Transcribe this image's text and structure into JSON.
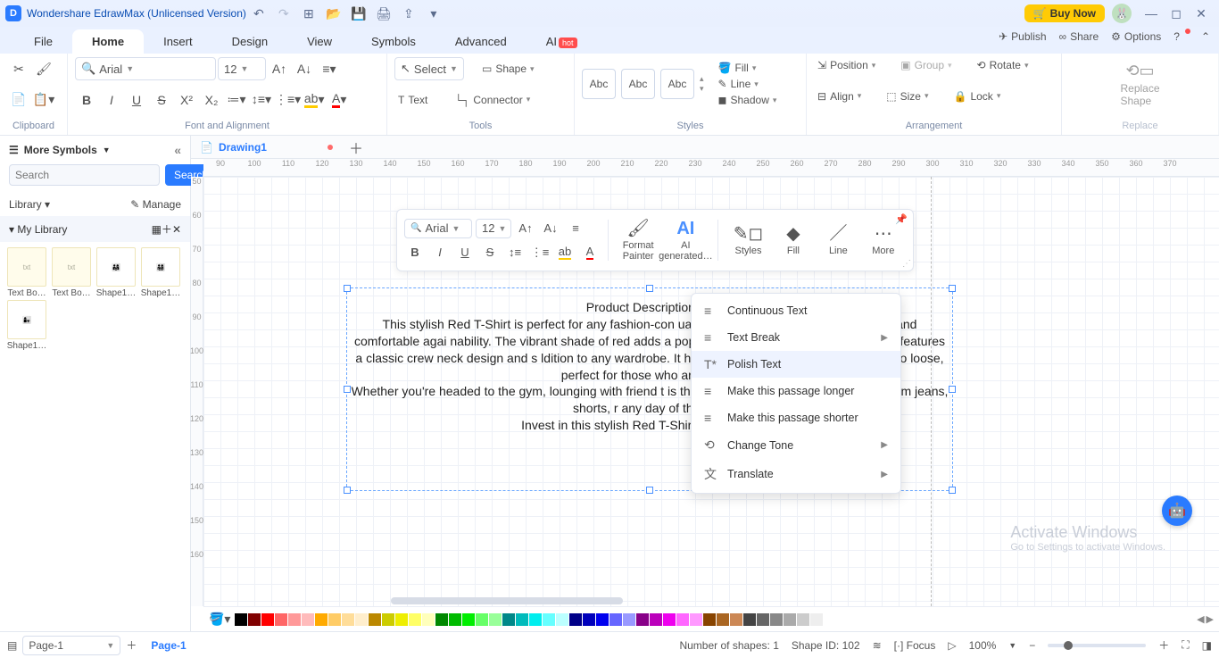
{
  "titlebar": {
    "app_name": "Wondershare EdrawMax (Unlicensed Version)",
    "buy_now": "Buy Now"
  },
  "menubar": {
    "tabs": [
      "File",
      "Home",
      "Insert",
      "Design",
      "View",
      "Symbols",
      "Advanced",
      "AI"
    ],
    "active": "Home",
    "right": {
      "publish": "Publish",
      "share": "Share",
      "options": "Options"
    }
  },
  "ribbon": {
    "font_name": "Arial",
    "font_size": "12",
    "select": "Select",
    "shape": "Shape",
    "text": "Text",
    "connector": "Connector",
    "fill": "Fill",
    "line": "Line",
    "shadow": "Shadow",
    "position": "Position",
    "align": "Align",
    "group": "Group",
    "size": "Size",
    "rotate": "Rotate",
    "lock": "Lock",
    "replace_shape": "Replace\nShape",
    "groups": {
      "clipboard": "Clipboard",
      "font": "Font and Alignment",
      "tools": "Tools",
      "styles": "Styles",
      "arrangement": "Arrangement",
      "replace": "Replace"
    },
    "abc": "Abc"
  },
  "leftpanel": {
    "more_symbols": "More Symbols",
    "search_placeholder": "Search",
    "search_btn": "Search",
    "library": "Library",
    "manage": "Manage",
    "my_library": "My Library",
    "items": [
      "Text Bo…",
      "Text Bo…",
      "Shape1…",
      "Shape1…",
      "Shape1…"
    ]
  },
  "doctab": {
    "name": "Drawing1"
  },
  "ruler_h": [
    "90",
    "100",
    "110",
    "120",
    "130",
    "140",
    "150",
    "160",
    "170",
    "180",
    "190",
    "200",
    "210",
    "220",
    "230",
    "240",
    "250",
    "260",
    "270",
    "280",
    "290",
    "300",
    "310",
    "320",
    "330",
    "340",
    "350",
    "360",
    "370"
  ],
  "ruler_v": [
    "50",
    "60",
    "70",
    "80",
    "90",
    "100",
    "110",
    "120",
    "130",
    "140",
    "150",
    "160"
  ],
  "canvas_text": {
    "title": "Product Description for",
    "body": "This stylish Red T-Shirt is perfect for any fashion-con                                                   uality cotton fabric, it not only feels soft and comfortable agai                                                   nability. The vibrant shade of red adds a pop of color to any ou                                                   asion. The T-Shirt features a classic crew neck design and s                                                   ldition to any wardrobe. It has a regular fit that drapes nicely                                                   or too loose, perfect for those who are after a\nWhether you're headed to the gym, lounging with friend                                                   t is the perfect choice. It pairs well with denim jeans, shorts,                                                   r any day of the wee\nInvest in this stylish Red T-Shirt today and add"
  },
  "floattb": {
    "font_name": "Arial",
    "font_size": "12",
    "format_painter": "Format\nPainter",
    "ai_generated": "AI\ngenerated…",
    "styles": "Styles",
    "fill": "Fill",
    "line": "Line",
    "more": "More"
  },
  "context_menu": {
    "items": [
      {
        "label": "Continuous Text",
        "sub": false
      },
      {
        "label": "Text Break",
        "sub": true
      },
      {
        "label": "Polish Text",
        "sub": false,
        "hover": true
      },
      {
        "label": "Make this passage longer",
        "sub": false
      },
      {
        "label": "Make this passage shorter",
        "sub": false
      },
      {
        "label": "Change Tone",
        "sub": true
      },
      {
        "label": "Translate",
        "sub": true
      }
    ]
  },
  "colorbar_colors": [
    "#000",
    "#800000",
    "#f00",
    "#f66",
    "#f99",
    "#fbb",
    "#fa0",
    "#fc6",
    "#fd9",
    "#fec",
    "#b80",
    "#cc0",
    "#ee0",
    "#ff6",
    "#ffb",
    "#080",
    "#0b0",
    "#0e0",
    "#6f6",
    "#9f9",
    "#088",
    "#0bb",
    "#0ee",
    "#6ff",
    "#bff",
    "#008",
    "#00b",
    "#00e",
    "#66f",
    "#99f",
    "#808",
    "#b0b",
    "#e0e",
    "#f6f",
    "#f9f",
    "#840",
    "#a62",
    "#c85",
    "#444",
    "#666",
    "#888",
    "#aaa",
    "#ccc",
    "#eee",
    "#fff"
  ],
  "statusbar": {
    "page_control": "Page-1",
    "page_tab": "Page-1",
    "num_shapes": "Number of shapes: 1",
    "shape_id": "Shape ID: 102",
    "focus": "Focus",
    "zoom": "100%"
  },
  "watermark": {
    "line1": "Activate Windows",
    "line2": "Go to Settings to activate Windows."
  }
}
